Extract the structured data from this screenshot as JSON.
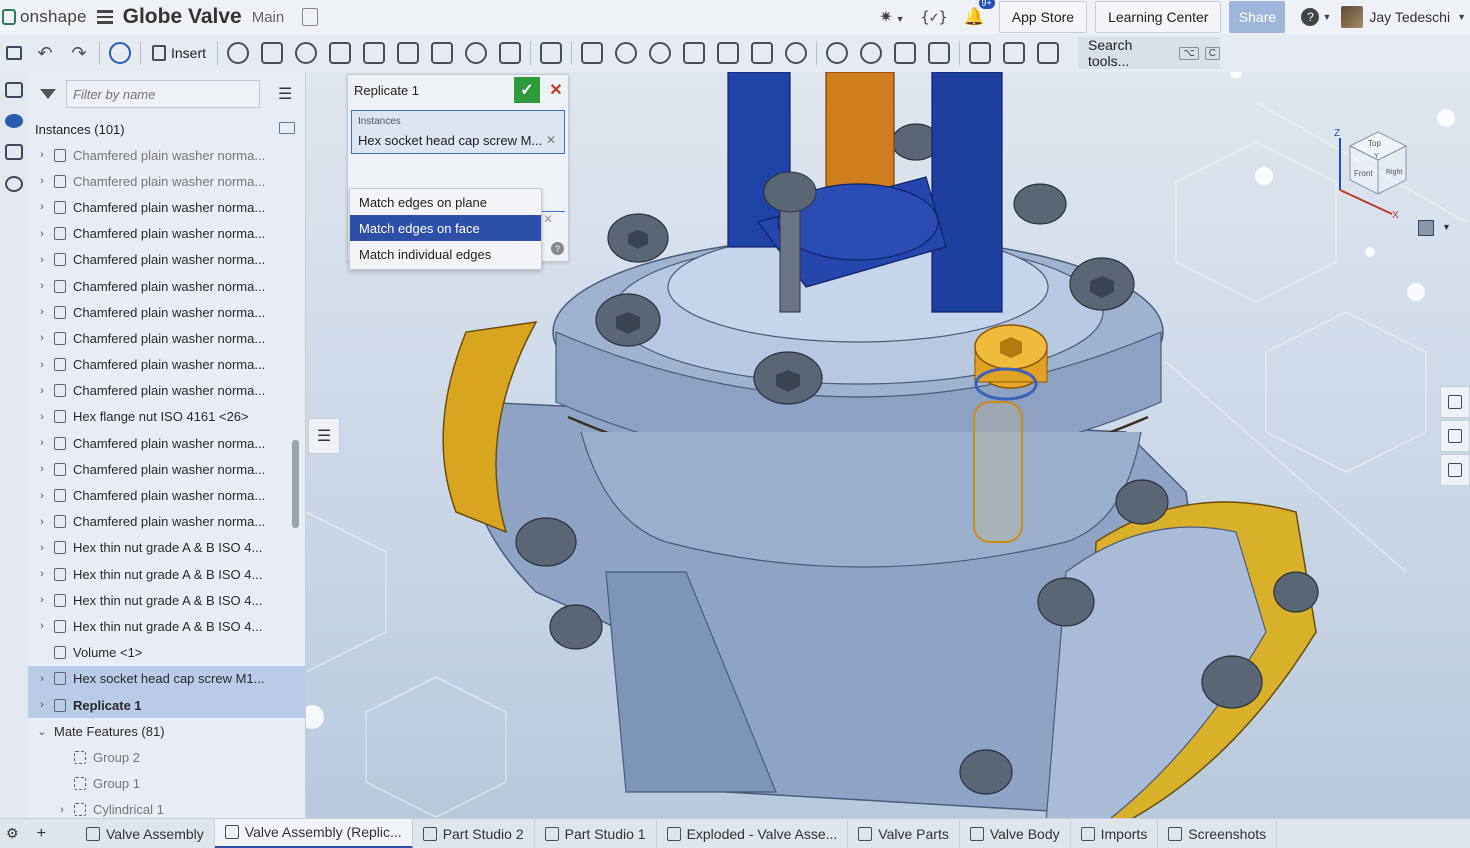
{
  "app": {
    "logo_text": "onshape",
    "doc_title": "Globe Valve",
    "branch": "Main",
    "notification_count": "9+",
    "app_store_label": "App Store",
    "learning_center_label": "Learning Center",
    "share_label": "Share",
    "user_name": "Jay Tedeschi"
  },
  "toolbar": {
    "insert_label": "Insert",
    "search_placeholder": "Search tools...",
    "search_shortcut_1": "⌥",
    "search_shortcut_2": "C"
  },
  "panel": {
    "filter_placeholder": "Filter by name",
    "instances_header": "Instances (101)",
    "items": [
      {
        "label": "Chamfered plain washer norma...",
        "kind": "part",
        "state": "dim"
      },
      {
        "label": "Chamfered plain washer norma...",
        "kind": "part",
        "state": "dim"
      },
      {
        "label": "Chamfered plain washer norma...",
        "kind": "part",
        "state": ""
      },
      {
        "label": "Chamfered plain washer norma...",
        "kind": "part",
        "state": ""
      },
      {
        "label": "Chamfered plain washer norma...",
        "kind": "part",
        "state": ""
      },
      {
        "label": "Chamfered plain washer norma...",
        "kind": "part",
        "state": ""
      },
      {
        "label": "Chamfered plain washer norma...",
        "kind": "part",
        "state": ""
      },
      {
        "label": "Chamfered plain washer norma...",
        "kind": "part",
        "state": ""
      },
      {
        "label": "Chamfered plain washer norma...",
        "kind": "part",
        "state": ""
      },
      {
        "label": "Chamfered plain washer norma...",
        "kind": "part",
        "state": ""
      },
      {
        "label": "Hex flange nut ISO 4161 <26>",
        "kind": "part",
        "state": ""
      },
      {
        "label": "Chamfered plain washer norma...",
        "kind": "part",
        "state": ""
      },
      {
        "label": "Chamfered plain washer norma...",
        "kind": "part",
        "state": ""
      },
      {
        "label": "Chamfered plain washer norma...",
        "kind": "part",
        "state": ""
      },
      {
        "label": "Chamfered plain washer norma...",
        "kind": "part",
        "state": ""
      },
      {
        "label": "Hex thin nut grade A & B ISO 4...",
        "kind": "part",
        "state": ""
      },
      {
        "label": "Hex thin nut grade A & B ISO 4...",
        "kind": "part",
        "state": ""
      },
      {
        "label": "Hex thin nut grade A & B ISO 4...",
        "kind": "part",
        "state": ""
      },
      {
        "label": "Hex thin nut grade A & B ISO 4...",
        "kind": "part",
        "state": ""
      },
      {
        "label": "Volume <1>",
        "kind": "volume",
        "state": "nochev"
      },
      {
        "label": "Hex socket head cap screw M1...",
        "kind": "part",
        "state": "selected"
      },
      {
        "label": "Replicate 1",
        "kind": "replicate",
        "state": "selected-bold"
      }
    ],
    "mate_header": "Mate Features (81)",
    "mate_items": [
      {
        "label": "Group 2"
      },
      {
        "label": "Group 1"
      },
      {
        "label": "Cylindrical 1"
      }
    ]
  },
  "dialog": {
    "title": "Replicate 1",
    "instances_label": "Instances",
    "instances_value": "Hex socket head cap screw M...",
    "options": [
      "Match edges on plane",
      "Match edges on face",
      "Match individual edges"
    ],
    "selected_option": "Match edges on face"
  },
  "viewcube": {
    "top": "Top",
    "front": "Front",
    "right": "Right",
    "axis_x": "X",
    "axis_y": "Y",
    "axis_z": "Z"
  },
  "tabs": [
    {
      "label": "Valve Assembly",
      "active": false
    },
    {
      "label": "Valve Assembly (Replic...",
      "active": true
    },
    {
      "label": "Part Studio 2",
      "active": false
    },
    {
      "label": "Part Studio 1",
      "active": false
    },
    {
      "label": "Exploded - Valve Asse...",
      "active": false
    },
    {
      "label": "Valve Parts",
      "active": false
    },
    {
      "label": "Valve Body",
      "active": false
    },
    {
      "label": "Imports",
      "active": false
    },
    {
      "label": "Screenshots",
      "active": false
    }
  ],
  "colors": {
    "accent": "#2d4fa7",
    "selection": "#b9cbe6",
    "confirm": "#2e9a3c",
    "cancel": "#c0392b",
    "flange_yellow": "#d9a520",
    "valve_body": "#8fa4c4"
  }
}
